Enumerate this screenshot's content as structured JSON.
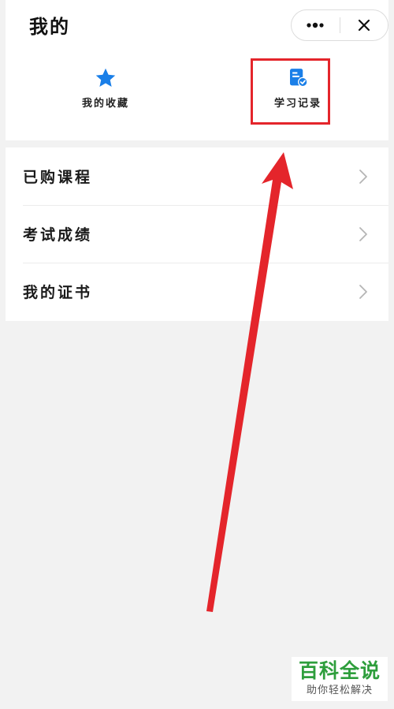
{
  "header": {
    "title": "我的",
    "more_icon": "more-dots-icon",
    "close_icon": "close-icon"
  },
  "shortcuts": [
    {
      "label": "我的收藏",
      "icon": "star-icon"
    },
    {
      "label": "学习记录",
      "icon": "study-record-icon"
    }
  ],
  "menu": {
    "items": [
      {
        "label": "已购课程"
      },
      {
        "label": "考试成绩"
      },
      {
        "label": "我的证书"
      }
    ]
  },
  "watermark": {
    "title": "百科全说",
    "subtitle": "助你轻松解决"
  },
  "colors": {
    "accent_blue": "#1a7fe8",
    "highlight_red": "#e4252b",
    "watermark_green": "#2e9e3c"
  }
}
